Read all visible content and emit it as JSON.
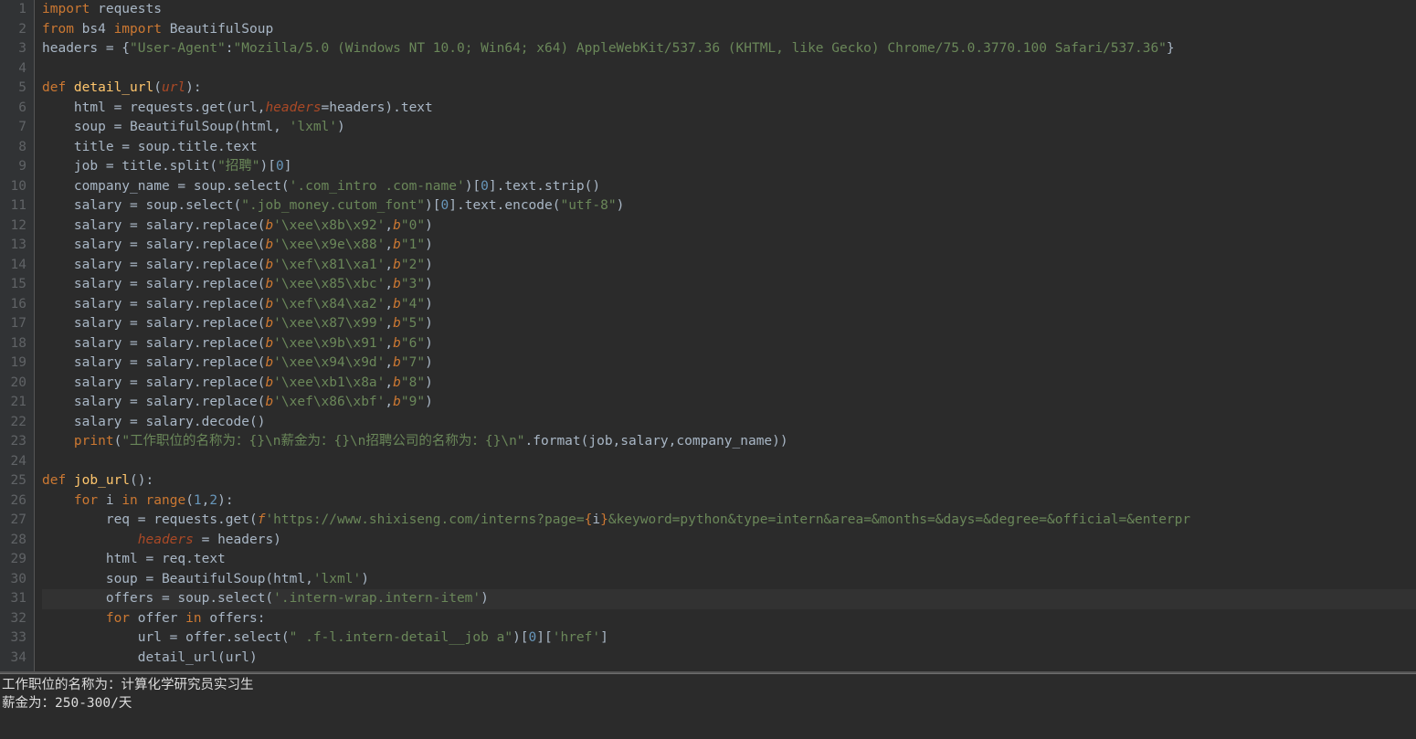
{
  "gutter": [
    "1",
    "2",
    "3",
    "4",
    "5",
    "6",
    "7",
    "8",
    "9",
    "10",
    "11",
    "12",
    "13",
    "14",
    "15",
    "16",
    "17",
    "18",
    "19",
    "20",
    "21",
    "22",
    "23",
    "24",
    "25",
    "26",
    "27",
    "28",
    "29",
    "30",
    "31",
    "32",
    "33",
    "34"
  ],
  "current_line_index": 30,
  "code": [
    [
      {
        "c": "kw",
        "t": "import"
      },
      {
        "c": "ident",
        "t": " requests"
      }
    ],
    [
      {
        "c": "kw",
        "t": "from"
      },
      {
        "c": "ident",
        "t": " bs4 "
      },
      {
        "c": "kw",
        "t": "import"
      },
      {
        "c": "ident",
        "t": " BeautifulSoup"
      }
    ],
    [
      {
        "c": "ident",
        "t": "headers = {"
      },
      {
        "c": "str",
        "t": "\"User-Agent\""
      },
      {
        "c": "ident",
        "t": ":"
      },
      {
        "c": "str",
        "t": "\"Mozilla/5.0 (Windows NT 10.0; Win64; x64) AppleWebKit/537.36 (KHTML, like Gecko) Chrome/75.0.3770.100 Safari/537.36\""
      },
      {
        "c": "ident",
        "t": "}"
      }
    ],
    [],
    [
      {
        "c": "kw",
        "t": "def "
      },
      {
        "c": "fn",
        "t": "detail_url"
      },
      {
        "c": "ident",
        "t": "("
      },
      {
        "c": "param-italic",
        "t": "url"
      },
      {
        "c": "ident",
        "t": "):"
      }
    ],
    [
      {
        "c": "ident",
        "t": "    html = requests.get(url,"
      },
      {
        "c": "param-italic",
        "t": "headers"
      },
      {
        "c": "ident",
        "t": "=headers).text"
      }
    ],
    [
      {
        "c": "ident",
        "t": "    soup = BeautifulSoup(html, "
      },
      {
        "c": "str",
        "t": "'lxml'"
      },
      {
        "c": "ident",
        "t": ")"
      }
    ],
    [
      {
        "c": "ident",
        "t": "    title = soup.title.text"
      }
    ],
    [
      {
        "c": "ident",
        "t": "    job = title.split("
      },
      {
        "c": "str",
        "t": "\"招聘\""
      },
      {
        "c": "ident",
        "t": ")["
      },
      {
        "c": "num",
        "t": "0"
      },
      {
        "c": "ident",
        "t": "]"
      }
    ],
    [
      {
        "c": "ident",
        "t": "    company_name = soup.select("
      },
      {
        "c": "str",
        "t": "'.com_intro .com-name'"
      },
      {
        "c": "ident",
        "t": ")["
      },
      {
        "c": "num",
        "t": "0"
      },
      {
        "c": "ident",
        "t": "].text.strip()"
      }
    ],
    [
      {
        "c": "ident",
        "t": "    salary = soup.select("
      },
      {
        "c": "str",
        "t": "\".job_money.cutom_font\""
      },
      {
        "c": "ident",
        "t": ")["
      },
      {
        "c": "num",
        "t": "0"
      },
      {
        "c": "ident",
        "t": "].text.encode("
      },
      {
        "c": "str",
        "t": "\"utf-8\""
      },
      {
        "c": "ident",
        "t": ")"
      }
    ],
    [
      {
        "c": "ident",
        "t": "    salary = salary.replace("
      },
      {
        "c": "bprefix",
        "t": "b"
      },
      {
        "c": "str",
        "t": "'\\xee\\x8b\\x92'"
      },
      {
        "c": "ident",
        "t": ","
      },
      {
        "c": "bprefix",
        "t": "b"
      },
      {
        "c": "str",
        "t": "\"0\""
      },
      {
        "c": "ident",
        "t": ")"
      }
    ],
    [
      {
        "c": "ident",
        "t": "    salary = salary.replace("
      },
      {
        "c": "bprefix",
        "t": "b"
      },
      {
        "c": "str",
        "t": "'\\xee\\x9e\\x88'"
      },
      {
        "c": "ident",
        "t": ","
      },
      {
        "c": "bprefix",
        "t": "b"
      },
      {
        "c": "str",
        "t": "\"1\""
      },
      {
        "c": "ident",
        "t": ")"
      }
    ],
    [
      {
        "c": "ident",
        "t": "    salary = salary.replace("
      },
      {
        "c": "bprefix",
        "t": "b"
      },
      {
        "c": "str",
        "t": "'\\xef\\x81\\xa1'"
      },
      {
        "c": "ident",
        "t": ","
      },
      {
        "c": "bprefix",
        "t": "b"
      },
      {
        "c": "str",
        "t": "\"2\""
      },
      {
        "c": "ident",
        "t": ")"
      }
    ],
    [
      {
        "c": "ident",
        "t": "    salary = salary.replace("
      },
      {
        "c": "bprefix",
        "t": "b"
      },
      {
        "c": "str",
        "t": "'\\xee\\x85\\xbc'"
      },
      {
        "c": "ident",
        "t": ","
      },
      {
        "c": "bprefix",
        "t": "b"
      },
      {
        "c": "str",
        "t": "\"3\""
      },
      {
        "c": "ident",
        "t": ")"
      }
    ],
    [
      {
        "c": "ident",
        "t": "    salary = salary.replace("
      },
      {
        "c": "bprefix",
        "t": "b"
      },
      {
        "c": "str",
        "t": "'\\xef\\x84\\xa2'"
      },
      {
        "c": "ident",
        "t": ","
      },
      {
        "c": "bprefix",
        "t": "b"
      },
      {
        "c": "str",
        "t": "\"4\""
      },
      {
        "c": "ident",
        "t": ")"
      }
    ],
    [
      {
        "c": "ident",
        "t": "    salary = salary.replace("
      },
      {
        "c": "bprefix",
        "t": "b"
      },
      {
        "c": "str",
        "t": "'\\xee\\x87\\x99'"
      },
      {
        "c": "ident",
        "t": ","
      },
      {
        "c": "bprefix",
        "t": "b"
      },
      {
        "c": "str",
        "t": "\"5\""
      },
      {
        "c": "ident",
        "t": ")"
      }
    ],
    [
      {
        "c": "ident",
        "t": "    salary = salary.replace("
      },
      {
        "c": "bprefix",
        "t": "b"
      },
      {
        "c": "str",
        "t": "'\\xee\\x9b\\x91'"
      },
      {
        "c": "ident",
        "t": ","
      },
      {
        "c": "bprefix",
        "t": "b"
      },
      {
        "c": "str",
        "t": "\"6\""
      },
      {
        "c": "ident",
        "t": ")"
      }
    ],
    [
      {
        "c": "ident",
        "t": "    salary = salary.replace("
      },
      {
        "c": "bprefix",
        "t": "b"
      },
      {
        "c": "str",
        "t": "'\\xee\\x94\\x9d'"
      },
      {
        "c": "ident",
        "t": ","
      },
      {
        "c": "bprefix",
        "t": "b"
      },
      {
        "c": "str",
        "t": "\"7\""
      },
      {
        "c": "ident",
        "t": ")"
      }
    ],
    [
      {
        "c": "ident",
        "t": "    salary = salary.replace("
      },
      {
        "c": "bprefix",
        "t": "b"
      },
      {
        "c": "str",
        "t": "'\\xee\\xb1\\x8a'"
      },
      {
        "c": "ident",
        "t": ","
      },
      {
        "c": "bprefix",
        "t": "b"
      },
      {
        "c": "str",
        "t": "\"8\""
      },
      {
        "c": "ident",
        "t": ")"
      }
    ],
    [
      {
        "c": "ident",
        "t": "    salary = salary.replace("
      },
      {
        "c": "bprefix",
        "t": "b"
      },
      {
        "c": "str",
        "t": "'\\xef\\x86\\xbf'"
      },
      {
        "c": "ident",
        "t": ","
      },
      {
        "c": "bprefix",
        "t": "b"
      },
      {
        "c": "str",
        "t": "\"9\""
      },
      {
        "c": "ident",
        "t": ")"
      }
    ],
    [
      {
        "c": "ident",
        "t": "    salary = salary.decode()"
      }
    ],
    [
      {
        "c": "ident",
        "t": "    "
      },
      {
        "c": "kw",
        "t": "print"
      },
      {
        "c": "ident",
        "t": "("
      },
      {
        "c": "str",
        "t": "\"工作职位的名称为：{}\\n薪金为：{}\\n招聘公司的名称为：{}\\n\""
      },
      {
        "c": "ident",
        "t": ".format(job,salary,company_name))"
      }
    ],
    [],
    [
      {
        "c": "kw",
        "t": "def "
      },
      {
        "c": "fn",
        "t": "job_url"
      },
      {
        "c": "ident",
        "t": "():"
      }
    ],
    [
      {
        "c": "ident",
        "t": "    "
      },
      {
        "c": "kw",
        "t": "for"
      },
      {
        "c": "ident",
        "t": " i "
      },
      {
        "c": "kw",
        "t": "in"
      },
      {
        "c": "ident",
        "t": " "
      },
      {
        "c": "kw",
        "t": "range"
      },
      {
        "c": "ident",
        "t": "("
      },
      {
        "c": "num",
        "t": "1"
      },
      {
        "c": "ident",
        "t": ","
      },
      {
        "c": "num",
        "t": "2"
      },
      {
        "c": "ident",
        "t": "):"
      }
    ],
    [
      {
        "c": "ident",
        "t": "        req = requests.get("
      },
      {
        "c": "bprefix",
        "t": "f"
      },
      {
        "c": "str",
        "t": "'https://www.shixiseng.com/interns?page="
      },
      {
        "c": "kw",
        "t": "{"
      },
      {
        "c": "ident",
        "t": "i"
      },
      {
        "c": "kw",
        "t": "}"
      },
      {
        "c": "str",
        "t": "&keyword=python&type=intern&area=&months=&days=&degree=&official=&enterpr"
      }
    ],
    [
      {
        "c": "ident",
        "t": "            "
      },
      {
        "c": "param-italic",
        "t": "headers"
      },
      {
        "c": "ident",
        "t": " = headers)"
      }
    ],
    [
      {
        "c": "ident",
        "t": "        html = req.text"
      }
    ],
    [
      {
        "c": "ident",
        "t": "        soup = BeautifulSoup(html,"
      },
      {
        "c": "str",
        "t": "'lxml'"
      },
      {
        "c": "ident",
        "t": ")"
      }
    ],
    [
      {
        "c": "ident",
        "t": "        offers = soup.select("
      },
      {
        "c": "str",
        "t": "'.intern-wrap.intern-item'"
      },
      {
        "c": "ident",
        "t": ")"
      }
    ],
    [
      {
        "c": "ident",
        "t": "        "
      },
      {
        "c": "kw",
        "t": "for"
      },
      {
        "c": "ident",
        "t": " offer "
      },
      {
        "c": "kw",
        "t": "in"
      },
      {
        "c": "ident",
        "t": " offers:"
      }
    ],
    [
      {
        "c": "ident",
        "t": "            url = offer.select("
      },
      {
        "c": "str",
        "t": "\" .f-l.intern-detail__job a\""
      },
      {
        "c": "ident",
        "t": ")["
      },
      {
        "c": "num",
        "t": "0"
      },
      {
        "c": "ident",
        "t": "]["
      },
      {
        "c": "str",
        "t": "'href'"
      },
      {
        "c": "ident",
        "t": "]"
      }
    ],
    [
      {
        "c": "ident",
        "t": "            detail_url(url)"
      }
    ]
  ],
  "terminal": {
    "lines": [
      "工作职位的名称为：计算化学研究员实习生",
      "薪金为：250-300/天"
    ]
  }
}
